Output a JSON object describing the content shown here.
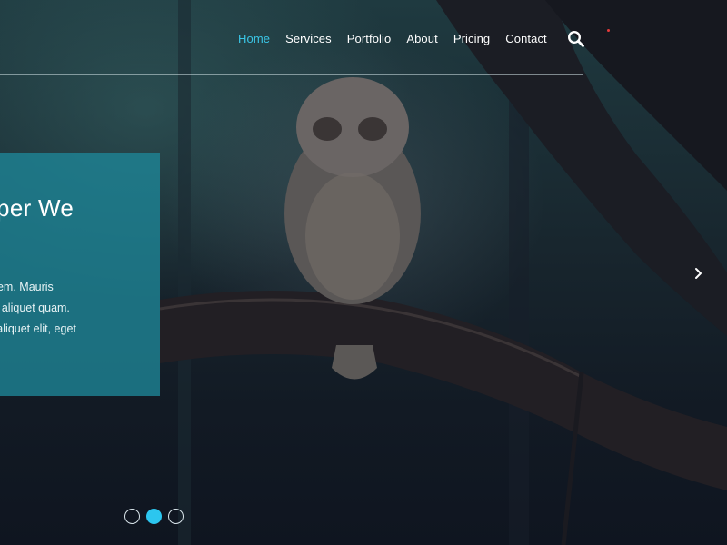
{
  "nav": {
    "items": [
      {
        "label": "Home",
        "active": true
      },
      {
        "label": "Services",
        "active": false
      },
      {
        "label": "Portfolio",
        "active": false
      },
      {
        "label": "About",
        "active": false
      },
      {
        "label": "Pricing",
        "active": false
      },
      {
        "label": "Contact",
        "active": false
      }
    ],
    "search_icon": "search-icon"
  },
  "slide": {
    "title": "asper We",
    "text_lines": [
      "itor at sem. Mauris",
      "urabitur aliquet quam.",
      "blandit aliquet elit, eget"
    ],
    "next_icon": "chevron-right-icon"
  },
  "carousel": {
    "slide_count": 3,
    "active_index": 1
  },
  "colors": {
    "accent": "#3ac6e6",
    "caption_bg": "#1e8496",
    "dot_active": "#2cc6ef"
  }
}
